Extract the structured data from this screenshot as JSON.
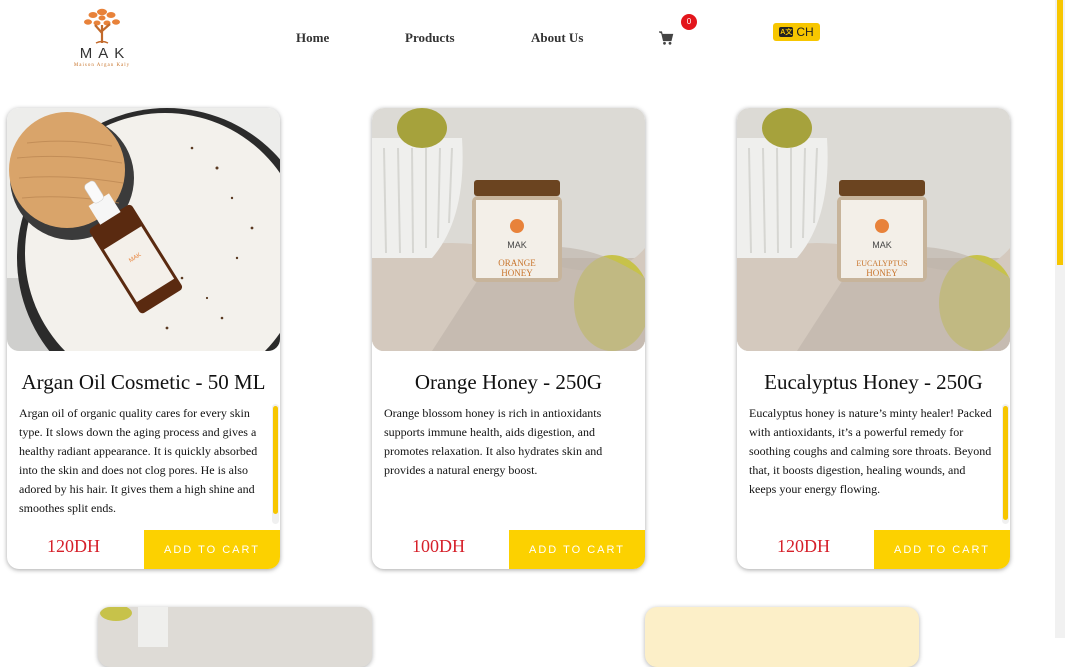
{
  "brand": {
    "name": "MAK",
    "tagline": "Maison Argan Kaly"
  },
  "nav": {
    "home": "Home",
    "products": "Products",
    "about": "About Us",
    "cart_count": "0",
    "lang_icon": "A文",
    "lang_label": "CH"
  },
  "products": [
    {
      "title": "Argan Oil Cosmetic - 50 ML",
      "description": "Argan oil of organic quality cares for every skin type. It slows down the aging process and gives a healthy radiant appearance. It is quickly absorbed into the skin and does not clog pores. He is also adored by his hair. It gives them a high shine and smoothes split ends.",
      "price": "120DH",
      "button": "ADD TO CART",
      "scroll_position": 0.0
    },
    {
      "title": "Orange Honey - 250G",
      "description": "Orange blossom honey is rich in antioxidants supports immune health, aids digestion, and promotes relaxation. It also hydrates skin and provides a natural energy boost.",
      "price": "100DH",
      "button": "ADD TO CART",
      "label_line1": "ORANGE",
      "label_line2": "HONEY"
    },
    {
      "title": "Eucalyptus Honey - 250G",
      "description": "Eucalyptus honey is nature’s minty healer! Packed with antioxidants, it’s a powerful remedy for soothing coughs and calming sore throats. Beyond that, it boosts digestion, healing wounds, and keeps your energy flowing.",
      "price": "120DH",
      "button": "ADD TO CART",
      "label_line1": "EUCALYPTUS",
      "label_line2": "HONEY",
      "scroll_position": 1.0
    }
  ],
  "colors": {
    "accent": "#fcd100",
    "price": "#d6202a",
    "badge": "#e3161c",
    "logo": "#e8823a"
  },
  "icons": [
    "tree-logo-icon",
    "cart-icon",
    "translate-icon"
  ]
}
